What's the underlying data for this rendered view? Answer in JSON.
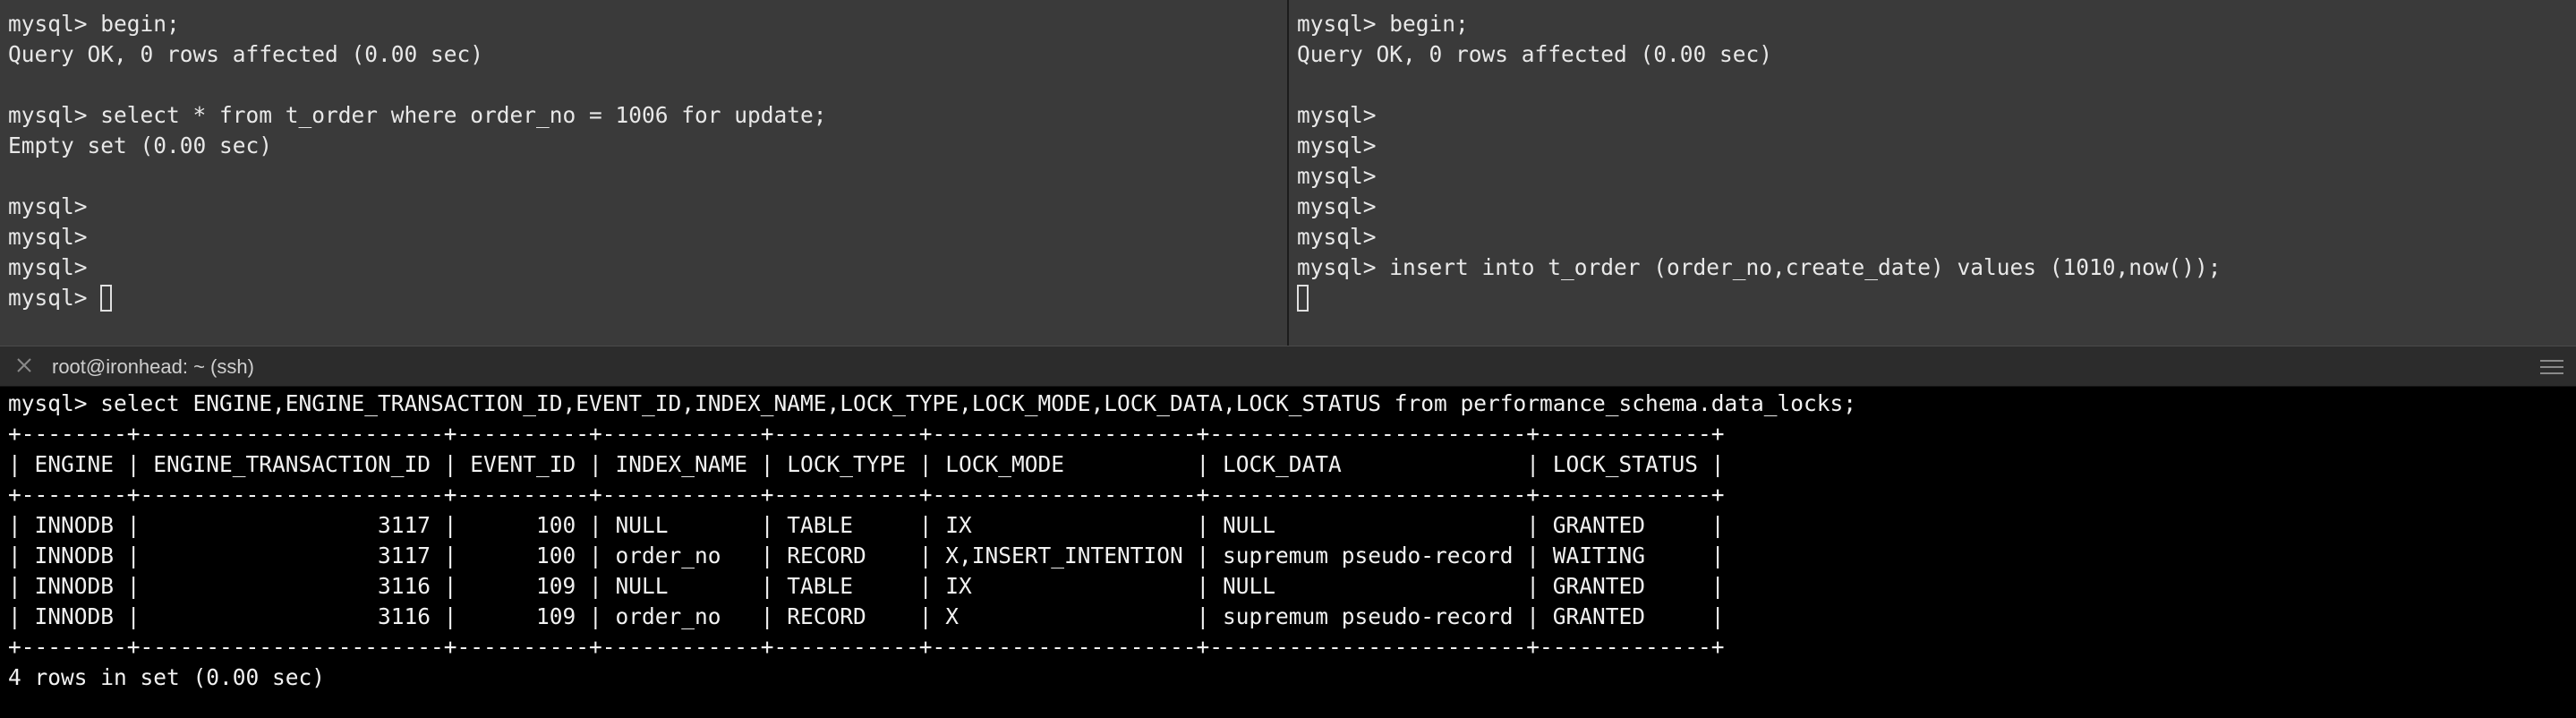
{
  "top_left": {
    "lines": [
      "mysql> begin;",
      "Query OK, 0 rows affected (0.00 sec)",
      "",
      "mysql> select * from t_order where order_no = 1006 for update;",
      "Empty set (0.00 sec)",
      "",
      "mysql>",
      "mysql>",
      "mysql>"
    ],
    "prompt_line": "mysql> "
  },
  "top_right": {
    "lines": [
      "mysql> begin;",
      "Query OK, 0 rows affected (0.00 sec)",
      "",
      "mysql>",
      "mysql>",
      "mysql>",
      "mysql>",
      "mysql>",
      "mysql> insert into t_order (order_no,create_date) values (1010,now());"
    ]
  },
  "titlebar": {
    "title": "root@ironhead: ~ (ssh)",
    "close_icon": "close-icon",
    "menu_icon": "hamburger-menu-icon"
  },
  "bottom": {
    "query": "mysql> select ENGINE,ENGINE_TRANSACTION_ID,EVENT_ID,INDEX_NAME,LOCK_TYPE,LOCK_MODE,LOCK_DATA,LOCK_STATUS from performance_schema.data_locks;",
    "border": "+--------+-----------------------+----------+------------+-----------+--------------------+------------------------+-------------+",
    "header": "| ENGINE | ENGINE_TRANSACTION_ID | EVENT_ID | INDEX_NAME | LOCK_TYPE | LOCK_MODE          | LOCK_DATA              | LOCK_STATUS |",
    "columns": [
      "ENGINE",
      "ENGINE_TRANSACTION_ID",
      "EVENT_ID",
      "INDEX_NAME",
      "LOCK_TYPE",
      "LOCK_MODE",
      "LOCK_DATA",
      "LOCK_STATUS"
    ],
    "rows": [
      [
        "INNODB",
        "3117",
        "100",
        "NULL",
        "TABLE",
        "IX",
        "NULL",
        "GRANTED"
      ],
      [
        "INNODB",
        "3117",
        "100",
        "order_no",
        "RECORD",
        "X,INSERT_INTENTION",
        "supremum pseudo-record",
        "WAITING"
      ],
      [
        "INNODB",
        "3116",
        "109",
        "NULL",
        "TABLE",
        "IX",
        "NULL",
        "GRANTED"
      ],
      [
        "INNODB",
        "3116",
        "109",
        "order_no",
        "RECORD",
        "X",
        "supremum pseudo-record",
        "GRANTED"
      ]
    ],
    "footer": "4 rows in set (0.00 sec)"
  }
}
